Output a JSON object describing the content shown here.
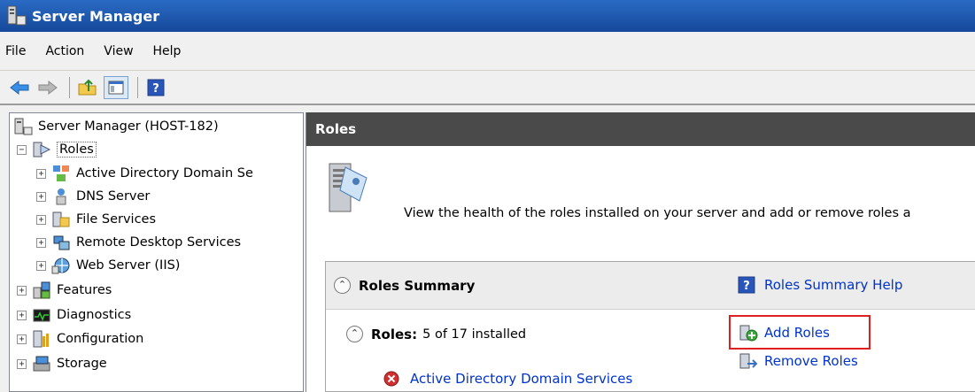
{
  "window": {
    "title": "Server Manager"
  },
  "menu": {
    "items": [
      "File",
      "Action",
      "View",
      "Help"
    ]
  },
  "tree": {
    "root": "Server Manager (HOST-182)",
    "roles": "Roles",
    "role_items": [
      "Active Directory Domain Se",
      "DNS Server",
      "File Services",
      "Remote Desktop Services",
      "Web Server (IIS)"
    ],
    "features": "Features",
    "diagnostics": "Diagnostics",
    "configuration": "Configuration",
    "storage": "Storage"
  },
  "content": {
    "header": "Roles",
    "description": "View the health of the roles installed on your server and add or remove roles a",
    "summary": {
      "title": "Roles Summary",
      "help_link": "Roles Summary Help",
      "roles_label": "Roles:",
      "roles_count": "5 of 17 installed",
      "add_roles": "Add Roles",
      "remove_roles": "Remove Roles",
      "first_role": "Active Directory Domain Services"
    }
  },
  "colors": {
    "titlebar": "#1f5bb3",
    "content_header": "#4a4a4a",
    "link": "#0033cc",
    "highlight": "#e02020",
    "error": "#d03030"
  }
}
